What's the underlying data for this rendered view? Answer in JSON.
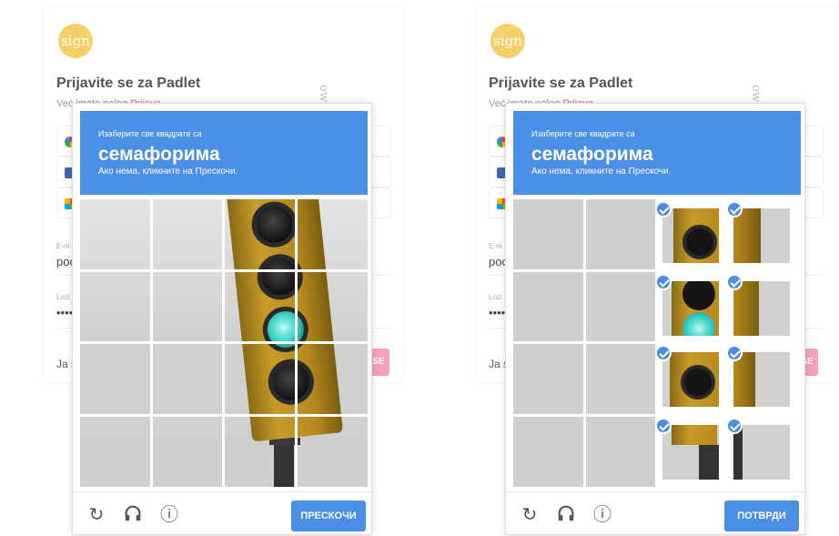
{
  "bg_form": {
    "logo_text": "sign",
    "title": "Prijavite se za Padlet",
    "have_account": "Već imate nalog",
    "login_link": "Prijava",
    "vertical_text": "own",
    "email_label": "E-m",
    "email_value": "poc",
    "password_label": "Lozi",
    "password_value": "••••",
    "footer_text": "Ja s",
    "signup_btn": "SE"
  },
  "left_captcha": {
    "instruction": "Изаберите све квадрате са",
    "target": "семафорима",
    "hint": "Ако нема, кликните на Прескочи.",
    "button": "ПРЕСКОЧИ",
    "icons": [
      "reload-icon",
      "headphones-icon",
      "info-icon"
    ]
  },
  "right_captcha": {
    "instruction": "Изаберите све квадрате са",
    "target": "семафорима",
    "hint": "Ако нема, кликните на Прескочи.",
    "button": "ПОТВРДИ",
    "selected_tiles": 8,
    "icons": [
      "reload-icon",
      "headphones-icon",
      "info-icon"
    ]
  },
  "icons": {
    "reload": "↻",
    "headphones": "🎧",
    "info": "ⓘ"
  }
}
